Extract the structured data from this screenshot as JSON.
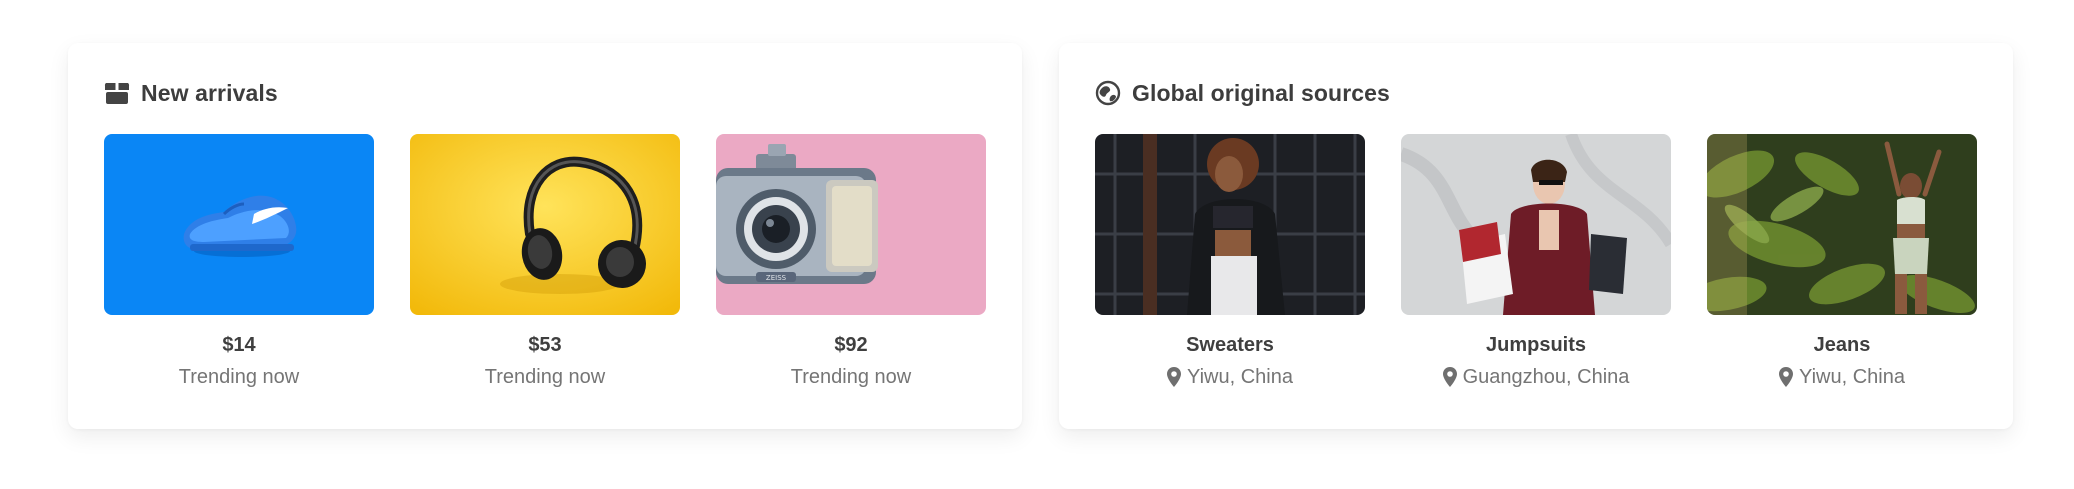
{
  "new_arrivals": {
    "title": "New arrivals",
    "icon": "box-icon",
    "items": [
      {
        "price": "$14",
        "caption": "Trending now",
        "image": "blue-sneaker",
        "bg": "#0a86f5"
      },
      {
        "price": "$53",
        "caption": "Trending now",
        "image": "black-headphones",
        "bg": "#f7c91c"
      },
      {
        "price": "$92",
        "caption": "Trending now",
        "image": "vintage-camera",
        "bg": "#eba9c4"
      }
    ]
  },
  "global_sources": {
    "title": "Global original sources",
    "icon": "globe-icon",
    "items": [
      {
        "category": "Sweaters",
        "location": "Yiwu, China",
        "image": "woman-dark-background"
      },
      {
        "category": "Jumpsuits",
        "location": "Guangzhou, China",
        "image": "woman-shopping-bags"
      },
      {
        "category": "Jeans",
        "location": "Yiwu, China",
        "image": "woman-green-foliage"
      }
    ]
  },
  "colors": {
    "heading": "#3d3d3d",
    "subtext": "#757575"
  }
}
